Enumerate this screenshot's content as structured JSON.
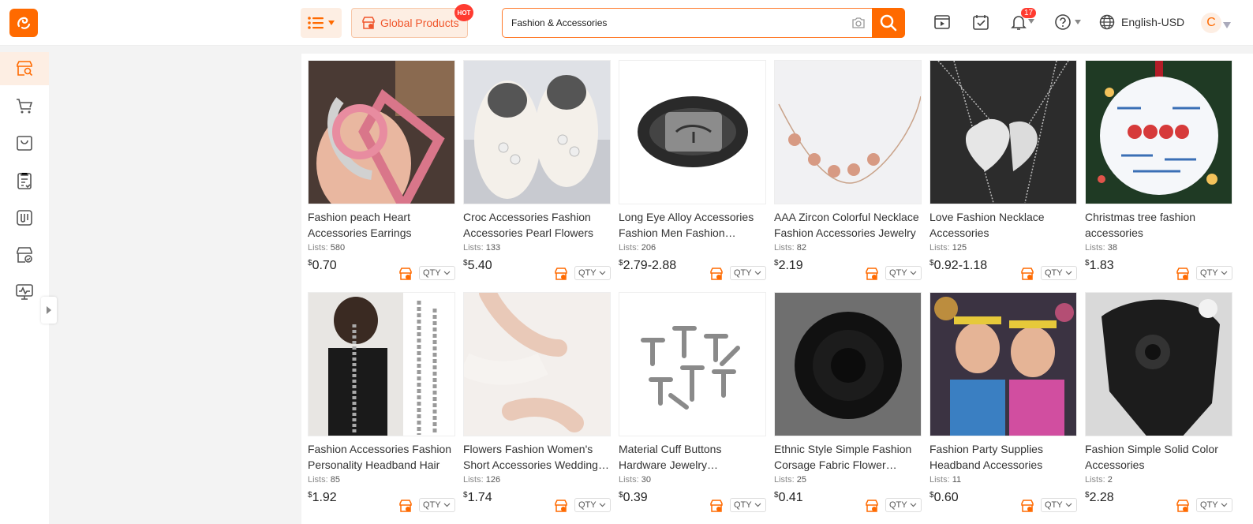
{
  "header": {
    "global_label": "Global Products",
    "hot_badge": "HOT",
    "search_value": "Fashion & Accessories",
    "notif_count": "17",
    "language": "English-USD",
    "avatar_letter": "C",
    "accent": "#ff6a00"
  },
  "sidebar": {
    "items": [
      {
        "icon": "product-search-icon",
        "active": true
      },
      {
        "icon": "cart-icon"
      },
      {
        "icon": "bag-icon"
      },
      {
        "icon": "orders-list-icon"
      },
      {
        "icon": "sourcing-icon"
      },
      {
        "icon": "store-icon"
      },
      {
        "icon": "monitor-icon"
      }
    ]
  },
  "products": [
    {
      "title": "Fashion peach Heart Accessories Earrings",
      "lists_label": "Lists:",
      "lists": "580",
      "currency": "$",
      "price": "0.70",
      "qty": "QTY"
    },
    {
      "title": "Croc Accessories Fashion Accessories Pearl Flowers",
      "lists_label": "Lists:",
      "lists": "133",
      "currency": "$",
      "price": "5.40",
      "qty": "QTY"
    },
    {
      "title": "Long Eye Alloy Accessories Fashion Men Fashion Accessories",
      "lists_label": "Lists:",
      "lists": "206",
      "currency": "$",
      "price": "2.79-2.88",
      "qty": "QTY"
    },
    {
      "title": "AAA Zircon Colorful Necklace Fashion Accessories Jewelry",
      "lists_label": "Lists:",
      "lists": "82",
      "currency": "$",
      "price": "2.19",
      "qty": "QTY"
    },
    {
      "title": "Love Fashion Necklace Accessories",
      "lists_label": "Lists:",
      "lists": "125",
      "currency": "$",
      "price": "0.92-1.18",
      "qty": "QTY"
    },
    {
      "title": "Christmas tree fashion accessories",
      "lists_label": "Lists:",
      "lists": "38",
      "currency": "$",
      "price": "1.83",
      "qty": "QTY"
    },
    {
      "title": "Fashion Accessories Fashion Personality Headband Hair",
      "lists_label": "Lists:",
      "lists": "85",
      "currency": "$",
      "price": "1.92",
      "qty": "QTY"
    },
    {
      "title": "Flowers Fashion Women's Short Accessories Wedding Gloves",
      "lists_label": "Lists:",
      "lists": "126",
      "currency": "$",
      "price": "1.74",
      "qty": "QTY"
    },
    {
      "title": "Material Cuff Buttons Hardware Jewelry Accessories",
      "lists_label": "Lists:",
      "lists": "30",
      "currency": "$",
      "price": "0.39",
      "qty": "QTY"
    },
    {
      "title": "Ethnic Style Simple Fashion Corsage Fabric Flower Accessories",
      "lists_label": "Lists:",
      "lists": "25",
      "currency": "$",
      "price": "0.41",
      "qty": "QTY"
    },
    {
      "title": "Fashion Party Supplies Headband Accessories",
      "lists_label": "Lists:",
      "lists": "11",
      "currency": "$",
      "price": "0.60",
      "qty": "QTY"
    },
    {
      "title": "Fashion Simple Solid Color Accessories",
      "lists_label": "Lists:",
      "lists": "2",
      "currency": "$",
      "price": "2.28",
      "qty": "QTY"
    }
  ]
}
